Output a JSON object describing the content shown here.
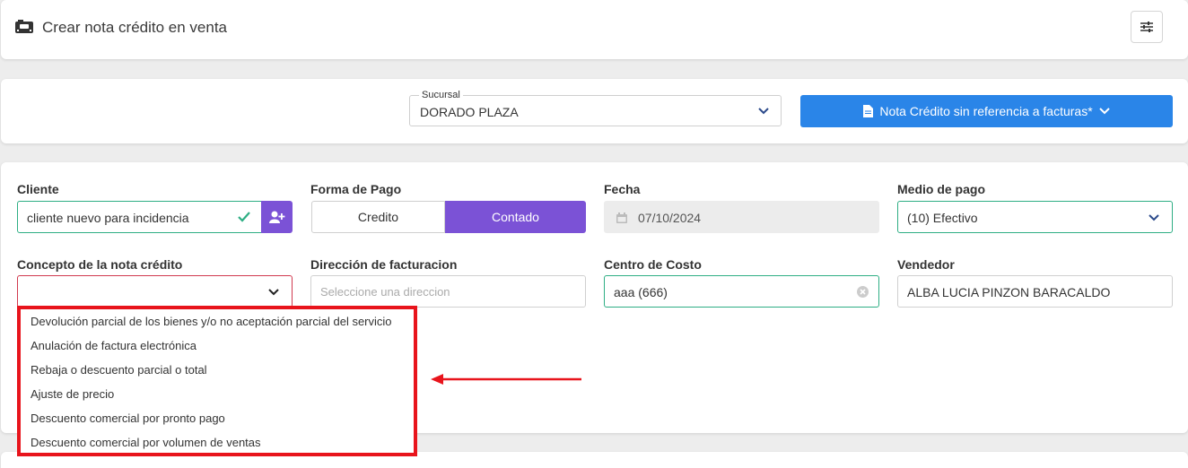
{
  "header": {
    "title": "Crear nota crédito en venta",
    "title_icon": "cash-register-icon",
    "settings_icon": "sliders-icon"
  },
  "toolbar": {
    "sucursal_label": "Sucursal",
    "sucursal_value": "DORADO PLAZA",
    "nota_button_label": "Nota Crédito sin referencia a facturas*"
  },
  "form": {
    "cliente": {
      "label": "Cliente",
      "value": "cliente nuevo para incidencia"
    },
    "forma_pago": {
      "label": "Forma de Pago",
      "options": [
        "Credito",
        "Contado"
      ],
      "selected": "Contado"
    },
    "fecha": {
      "label": "Fecha",
      "value": "07/10/2024"
    },
    "medio_pago": {
      "label": "Medio de pago",
      "value": "(10) Efectivo"
    },
    "concepto": {
      "label": "Concepto de la nota crédito",
      "value": ""
    },
    "direccion": {
      "label": "Dirección de facturacion",
      "placeholder": "Seleccione una direccion"
    },
    "centro_costo": {
      "label": "Centro de Costo",
      "value": "aaa (666)"
    },
    "vendedor": {
      "label": "Vendedor",
      "value": "ALBA LUCIA PINZON BARACALDO"
    }
  },
  "concepto_options": [
    "Devolución parcial de los bienes y/o no aceptación parcial del servicio",
    "Anulación de factura electrónica",
    "Rebaja o descuento parcial o total",
    "Ajuste de precio",
    "Descuento comercial por pronto pago",
    "Descuento comercial por volumen de ventas"
  ],
  "colors": {
    "primary": "#2a85e8",
    "purple": "#7b52d6",
    "success": "#2eae84",
    "highlight": "#e8141c"
  }
}
